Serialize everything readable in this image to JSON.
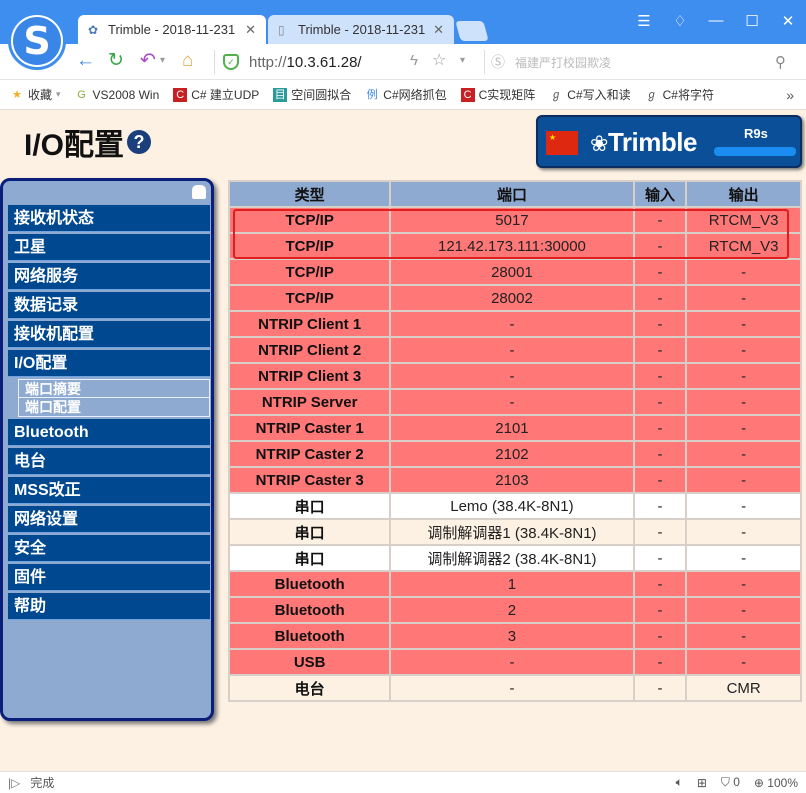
{
  "browser": {
    "tabs": [
      {
        "label": "Trimble - 2018-11-231",
        "active": true
      },
      {
        "label": "Trimble - 2018-11-231",
        "active": false
      }
    ],
    "url_scheme": "http://",
    "url_host": "10.3.61.28/",
    "search_placeholder": "福建严打校园欺凌",
    "bookmarks": [
      {
        "label": "收藏",
        "icon": "star-icon"
      },
      {
        "label": "VS2008 Win",
        "icon": "g-icon"
      },
      {
        "label": "C# 建立UDP",
        "icon": "c-icon"
      },
      {
        "label": "空间圆拟合",
        "icon": "doc-icon"
      },
      {
        "label": "C#网络抓包",
        "icon": "li-icon"
      },
      {
        "label": "C实现矩阵",
        "icon": "c-icon"
      },
      {
        "label": "C#写入和读",
        "icon": "paw-icon"
      },
      {
        "label": "C#将字符",
        "icon": "paw-icon"
      }
    ],
    "more_bookmarks": "»",
    "status_text": "完成",
    "ad_count": "0",
    "zoom_level": "100%"
  },
  "page": {
    "title": "I/O配置",
    "help_symbol": "?",
    "brand_name": "Trimble",
    "model": "R9s"
  },
  "sidebar": {
    "items": [
      {
        "label": "接收机状态"
      },
      {
        "label": "卫星"
      },
      {
        "label": "网络服务"
      },
      {
        "label": "数据记录"
      },
      {
        "label": "接收机配置"
      },
      {
        "label": "I/O配置"
      },
      {
        "label": "Bluetooth"
      },
      {
        "label": "电台"
      },
      {
        "label": "MSS改正"
      },
      {
        "label": "网络设置"
      },
      {
        "label": "安全"
      },
      {
        "label": "固件"
      },
      {
        "label": "帮助"
      }
    ],
    "sub_items": [
      {
        "label": "端口摘要"
      },
      {
        "label": "端口配置"
      }
    ]
  },
  "table": {
    "headers": [
      "类型",
      "端口",
      "输入",
      "输出"
    ],
    "rows": [
      {
        "type": "TCP/IP",
        "port": "5017",
        "input": "-",
        "output": "RTCM_V3",
        "style": "red"
      },
      {
        "type": "TCP/IP",
        "port": "121.42.173.111:30000",
        "input": "-",
        "output": "RTCM_V3",
        "style": "red"
      },
      {
        "type": "TCP/IP",
        "port": "28001",
        "input": "-",
        "output": "-",
        "style": "red"
      },
      {
        "type": "TCP/IP",
        "port": "28002",
        "input": "-",
        "output": "-",
        "style": "red"
      },
      {
        "type": "NTRIP Client 1",
        "port": "-",
        "input": "-",
        "output": "-",
        "style": "red"
      },
      {
        "type": "NTRIP Client 2",
        "port": "-",
        "input": "-",
        "output": "-",
        "style": "red"
      },
      {
        "type": "NTRIP Client 3",
        "port": "-",
        "input": "-",
        "output": "-",
        "style": "red"
      },
      {
        "type": "NTRIP Server",
        "port": "-",
        "input": "-",
        "output": "-",
        "style": "red"
      },
      {
        "type": "NTRIP Caster 1",
        "port": "2101",
        "input": "-",
        "output": "-",
        "style": "red"
      },
      {
        "type": "NTRIP Caster 2",
        "port": "2102",
        "input": "-",
        "output": "-",
        "style": "red"
      },
      {
        "type": "NTRIP Caster 3",
        "port": "2103",
        "input": "-",
        "output": "-",
        "style": "red"
      },
      {
        "type": "串口",
        "port": "Lemo (38.4K-8N1)",
        "input": "-",
        "output": "-",
        "style": "white"
      },
      {
        "type": "串口",
        "port": "调制解调器1 (38.4K-8N1)",
        "input": "-",
        "output": "-",
        "style": "cream"
      },
      {
        "type": "串口",
        "port": "调制解调器2 (38.4K-8N1)",
        "input": "-",
        "output": "-",
        "style": "white"
      },
      {
        "type": "Bluetooth",
        "port": "1",
        "input": "-",
        "output": "-",
        "style": "red"
      },
      {
        "type": "Bluetooth",
        "port": "2",
        "input": "-",
        "output": "-",
        "style": "red"
      },
      {
        "type": "Bluetooth",
        "port": "3",
        "input": "-",
        "output": "-",
        "style": "red"
      },
      {
        "type": "USB",
        "port": "-",
        "input": "-",
        "output": "-",
        "style": "red"
      },
      {
        "type": "电台",
        "port": "-",
        "input": "-",
        "output": "CMR",
        "style": "cream"
      }
    ]
  },
  "colors": {
    "disabled_row": "#ff7777",
    "nav_bg": "#00488f",
    "highlight_border": "#e21d1d"
  }
}
